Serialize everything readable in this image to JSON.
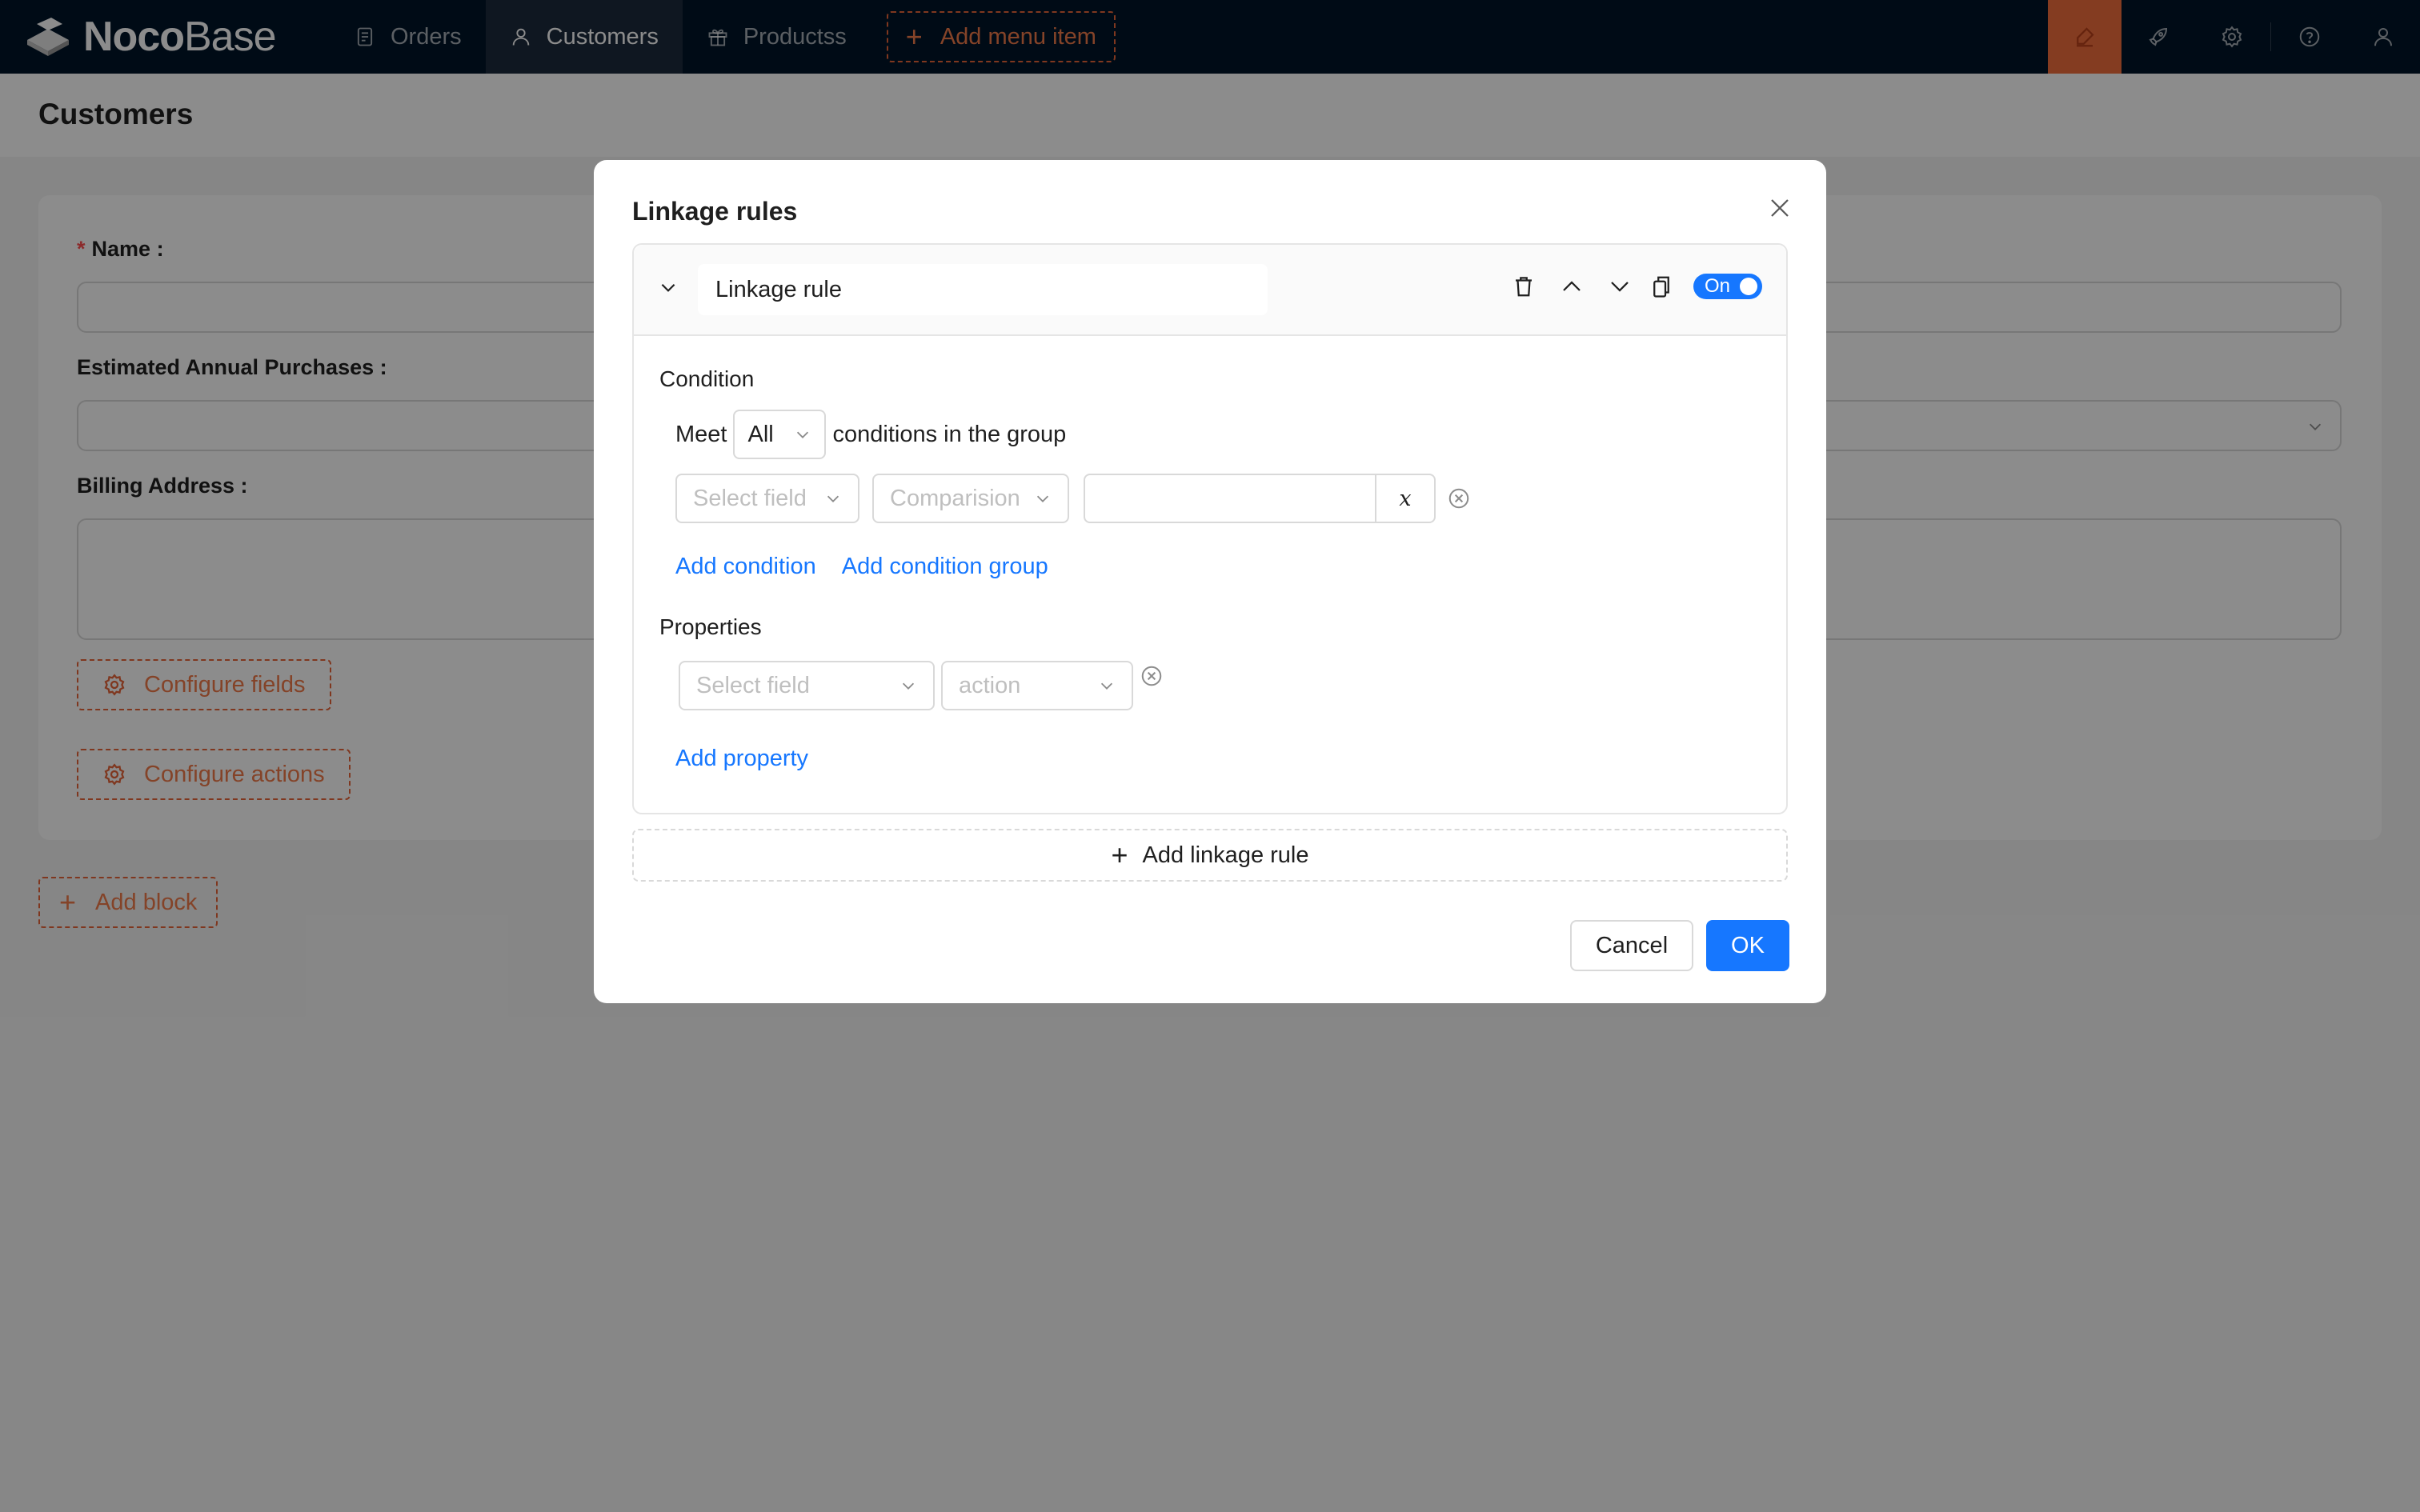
{
  "app": {
    "logo_bold": "Noco",
    "logo_light": "Base"
  },
  "nav": {
    "items": [
      {
        "label": "Orders",
        "icon": "file-icon"
      },
      {
        "label": "Customers",
        "icon": "user-icon",
        "active": true
      },
      {
        "label": "Productss",
        "icon": "gift-icon"
      }
    ],
    "add_menu_label": "Add menu item"
  },
  "page": {
    "title": "Customers",
    "form": {
      "fields": [
        {
          "label": "Name",
          "required": true
        },
        {
          "label": "Estimated Annual Purchases",
          "required": false
        },
        {
          "label": "Billing Address",
          "required": false
        }
      ],
      "configure_fields_label": "Configure fields",
      "configure_actions_label": "Configure actions"
    },
    "add_block_label": "Add block"
  },
  "modal": {
    "title": "Linkage rules",
    "rule": {
      "title": "Linkage rule",
      "toggle_label": "On",
      "toggle_on": true,
      "condition": {
        "section_title": "Condition",
        "meet_prefix": "Meet",
        "meet_value": "All",
        "meet_suffix": "conditions in the group",
        "field_placeholder": "Select field",
        "comparison_placeholder": "Comparision",
        "value_input": "",
        "variable_label": "x",
        "add_condition_label": "Add condition",
        "add_condition_group_label": "Add condition group"
      },
      "properties": {
        "section_title": "Properties",
        "field_placeholder": "Select field",
        "action_placeholder": "action",
        "add_property_label": "Add property"
      }
    },
    "add_rule_label": "Add linkage rule",
    "cancel_label": "Cancel",
    "ok_label": "OK"
  },
  "colors": {
    "nav_bg": "#001529",
    "accent_orange": "#f06d3c",
    "primary_blue": "#1677ff",
    "required_red": "#ff4d4f"
  }
}
